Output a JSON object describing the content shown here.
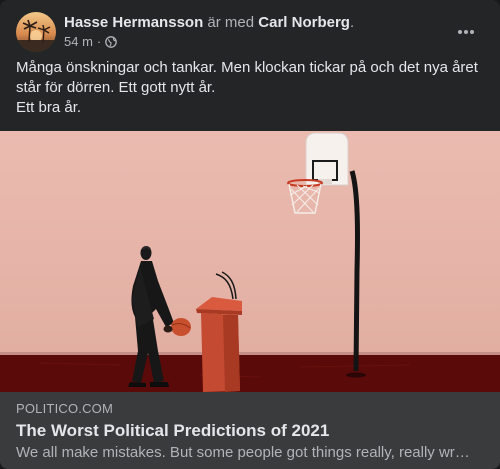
{
  "post": {
    "author": "Hasse Hermansson",
    "with_text": "är med",
    "tagged": "Carl Norberg",
    "period": ".",
    "time": "54 m",
    "separator": "·",
    "privacy_icon": "globe-icon",
    "more_icon": "more-horizontal-icon",
    "text_lines": [
      "Många önskningar och tankar. Men klockan tickar på och det nya året",
      "står för dörren. Ett gott nytt år.",
      "Ett bra år."
    ]
  },
  "link": {
    "domain": "POLITICO.COM",
    "title": "The Worst Political Predictions of 2021",
    "description": "We all make mistakes. But some people got things really, really wrong."
  },
  "colors": {
    "card_bg": "#242526",
    "link_bg": "#3a3b3c",
    "primary_text": "#e4e6eb",
    "secondary_text": "#b0b3b8",
    "wall": "#e8b7ad",
    "floor": "#5a0a08",
    "podium": "#c44a32"
  }
}
